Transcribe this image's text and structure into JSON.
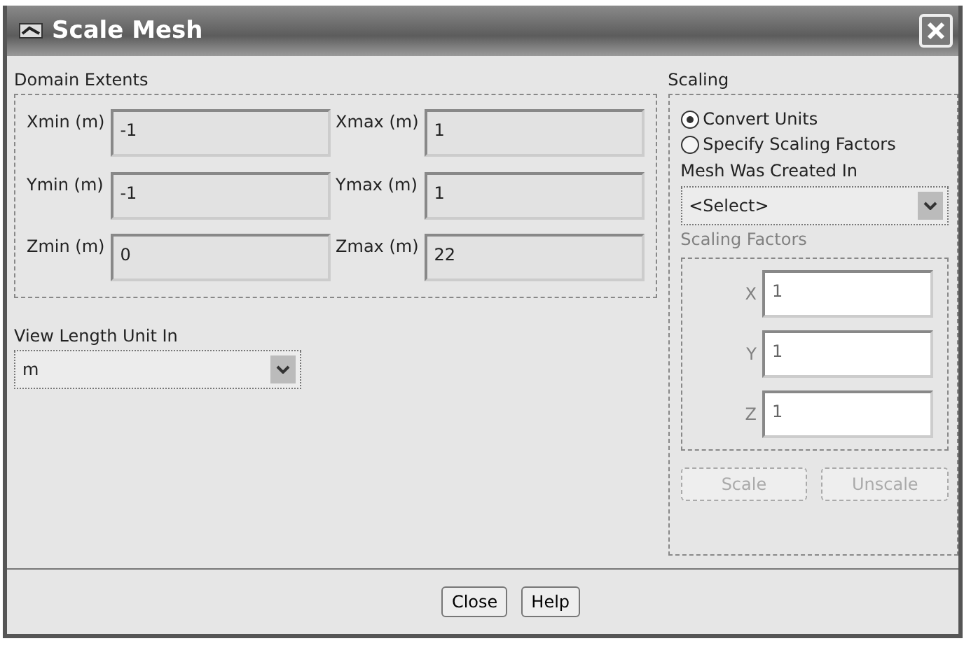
{
  "window": {
    "title": "Scale Mesh"
  },
  "domain_extents": {
    "label": "Domain Extents",
    "fields": [
      {
        "label": "Xmin (m)",
        "value": "-1"
      },
      {
        "label": "Xmax (m)",
        "value": "1"
      },
      {
        "label": "Ymin (m)",
        "value": "-1"
      },
      {
        "label": "Ymax (m)",
        "value": "1"
      },
      {
        "label": "Zmin (m)",
        "value": "0"
      },
      {
        "label": "Zmax (m)",
        "value": "22"
      }
    ]
  },
  "view_length_unit": {
    "label": "View Length Unit In",
    "value": "m"
  },
  "scaling": {
    "label": "Scaling",
    "options": [
      {
        "label": "Convert Units",
        "selected": true
      },
      {
        "label": "Specify Scaling Factors",
        "selected": false
      }
    ],
    "mesh_created_in": {
      "label": "Mesh Was Created In",
      "value": "<Select>"
    },
    "scaling_factors": {
      "label": "Scaling Factors",
      "disabled": true,
      "fields": [
        {
          "label": "X",
          "value": "1"
        },
        {
          "label": "Y",
          "value": "1"
        },
        {
          "label": "Z",
          "value": "1"
        }
      ]
    },
    "buttons": [
      {
        "label": "Scale",
        "disabled": true
      },
      {
        "label": "Unscale",
        "disabled": true
      }
    ]
  },
  "footer_buttons": [
    {
      "label": "Close"
    },
    {
      "label": "Help"
    }
  ]
}
